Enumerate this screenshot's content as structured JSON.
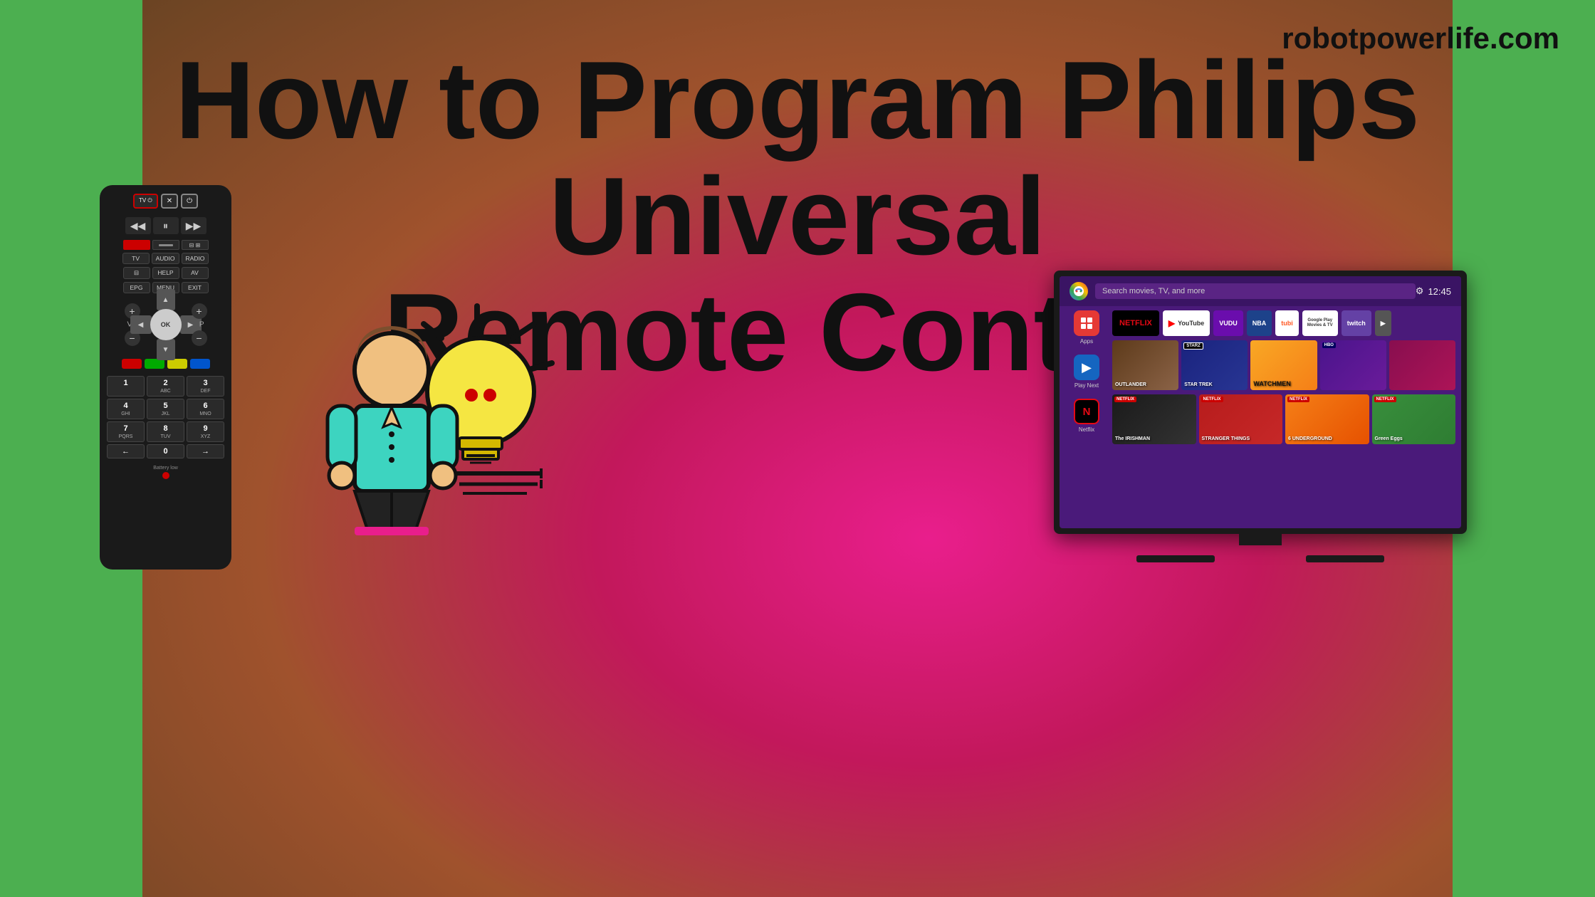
{
  "page": {
    "background": {
      "left_color": "#4caf50",
      "right_color": "#4caf50",
      "center_gradient": "radial pink-brown"
    },
    "site_url": "robotpowerlife.com",
    "title_line1": "How to Program Philips Universal",
    "title_line2": "Remote Control"
  },
  "remote": {
    "top_buttons": [
      "TV ⏻",
      "✕",
      "⏻"
    ],
    "transport": [
      "⏮",
      "⏸",
      "⏭"
    ],
    "rec_label": "●",
    "rows": [
      [
        "TV",
        "AUDIO",
        "RADIO"
      ],
      [
        "⊟",
        "HELP",
        "AV"
      ],
      [
        "EPG",
        "MENU",
        "EXIT"
      ]
    ],
    "ok_label": "OK",
    "vol_v": "V",
    "vol_p": "P",
    "color_buttons": [
      "red",
      "green",
      "yellow",
      "blue"
    ],
    "numpad": [
      {
        "main": "1",
        "sub": ""
      },
      {
        "main": "2",
        "sub": "ABC"
      },
      {
        "main": "3",
        "sub": "DEF"
      },
      {
        "main": "4",
        "sub": "GHI"
      },
      {
        "main": "5",
        "sub": "JKL"
      },
      {
        "main": "6",
        "sub": "MNO"
      },
      {
        "main": "7",
        "sub": "PQRS"
      },
      {
        "main": "8",
        "sub": "TUV"
      },
      {
        "main": "9",
        "sub": "XYZ"
      },
      {
        "main": "<",
        "sub": ""
      },
      {
        "main": "0",
        "sub": ""
      },
      {
        "main": ">",
        "sub": ""
      }
    ],
    "battery_label": "Battery low"
  },
  "tv": {
    "search_placeholder": "Search movies, TV, and more",
    "time": "12:45",
    "sidebar": {
      "items": [
        {
          "icon": "⊞",
          "label": "Apps"
        },
        {
          "icon": "▶",
          "label": "Play Next"
        },
        {
          "icon": "N",
          "label": "Netflix"
        }
      ]
    },
    "apps": [
      "NETFLIX",
      "▶ YouTube",
      "VUDU",
      "NBA",
      "tubi",
      "Google Play\nMovies & TV",
      "twitch",
      "▶"
    ],
    "content_rows": [
      {
        "items": [
          {
            "title": "OUTLANDER",
            "badge": "",
            "color": "outlander"
          },
          {
            "title": "STAR TREK\nDISCOVERY",
            "badge": "STARZ",
            "color": "startrek"
          },
          {
            "title": "WATCHMEN",
            "badge": "",
            "color": "watchmen"
          },
          {
            "title": "",
            "badge": "HBO",
            "color": "hbo1"
          },
          {
            "title": "",
            "badge": "",
            "color": "mystery1"
          }
        ]
      },
      {
        "items": [
          {
            "title": "The IRISHMAN",
            "badge": "NETFLIX",
            "color": "irishman"
          },
          {
            "title": "STRANGER THINGS",
            "badge": "NETFLIX",
            "color": "strangerthings"
          },
          {
            "title": "6 UNDERGROUND",
            "badge": "NETFLIX",
            "color": "underground"
          },
          {
            "title": "Green Eggs",
            "badge": "NETFLIX",
            "color": "greeneggs"
          }
        ]
      }
    ]
  },
  "illustration": {
    "person": "person with lightbulb idea",
    "alt": "Person and lightbulb illustration"
  }
}
